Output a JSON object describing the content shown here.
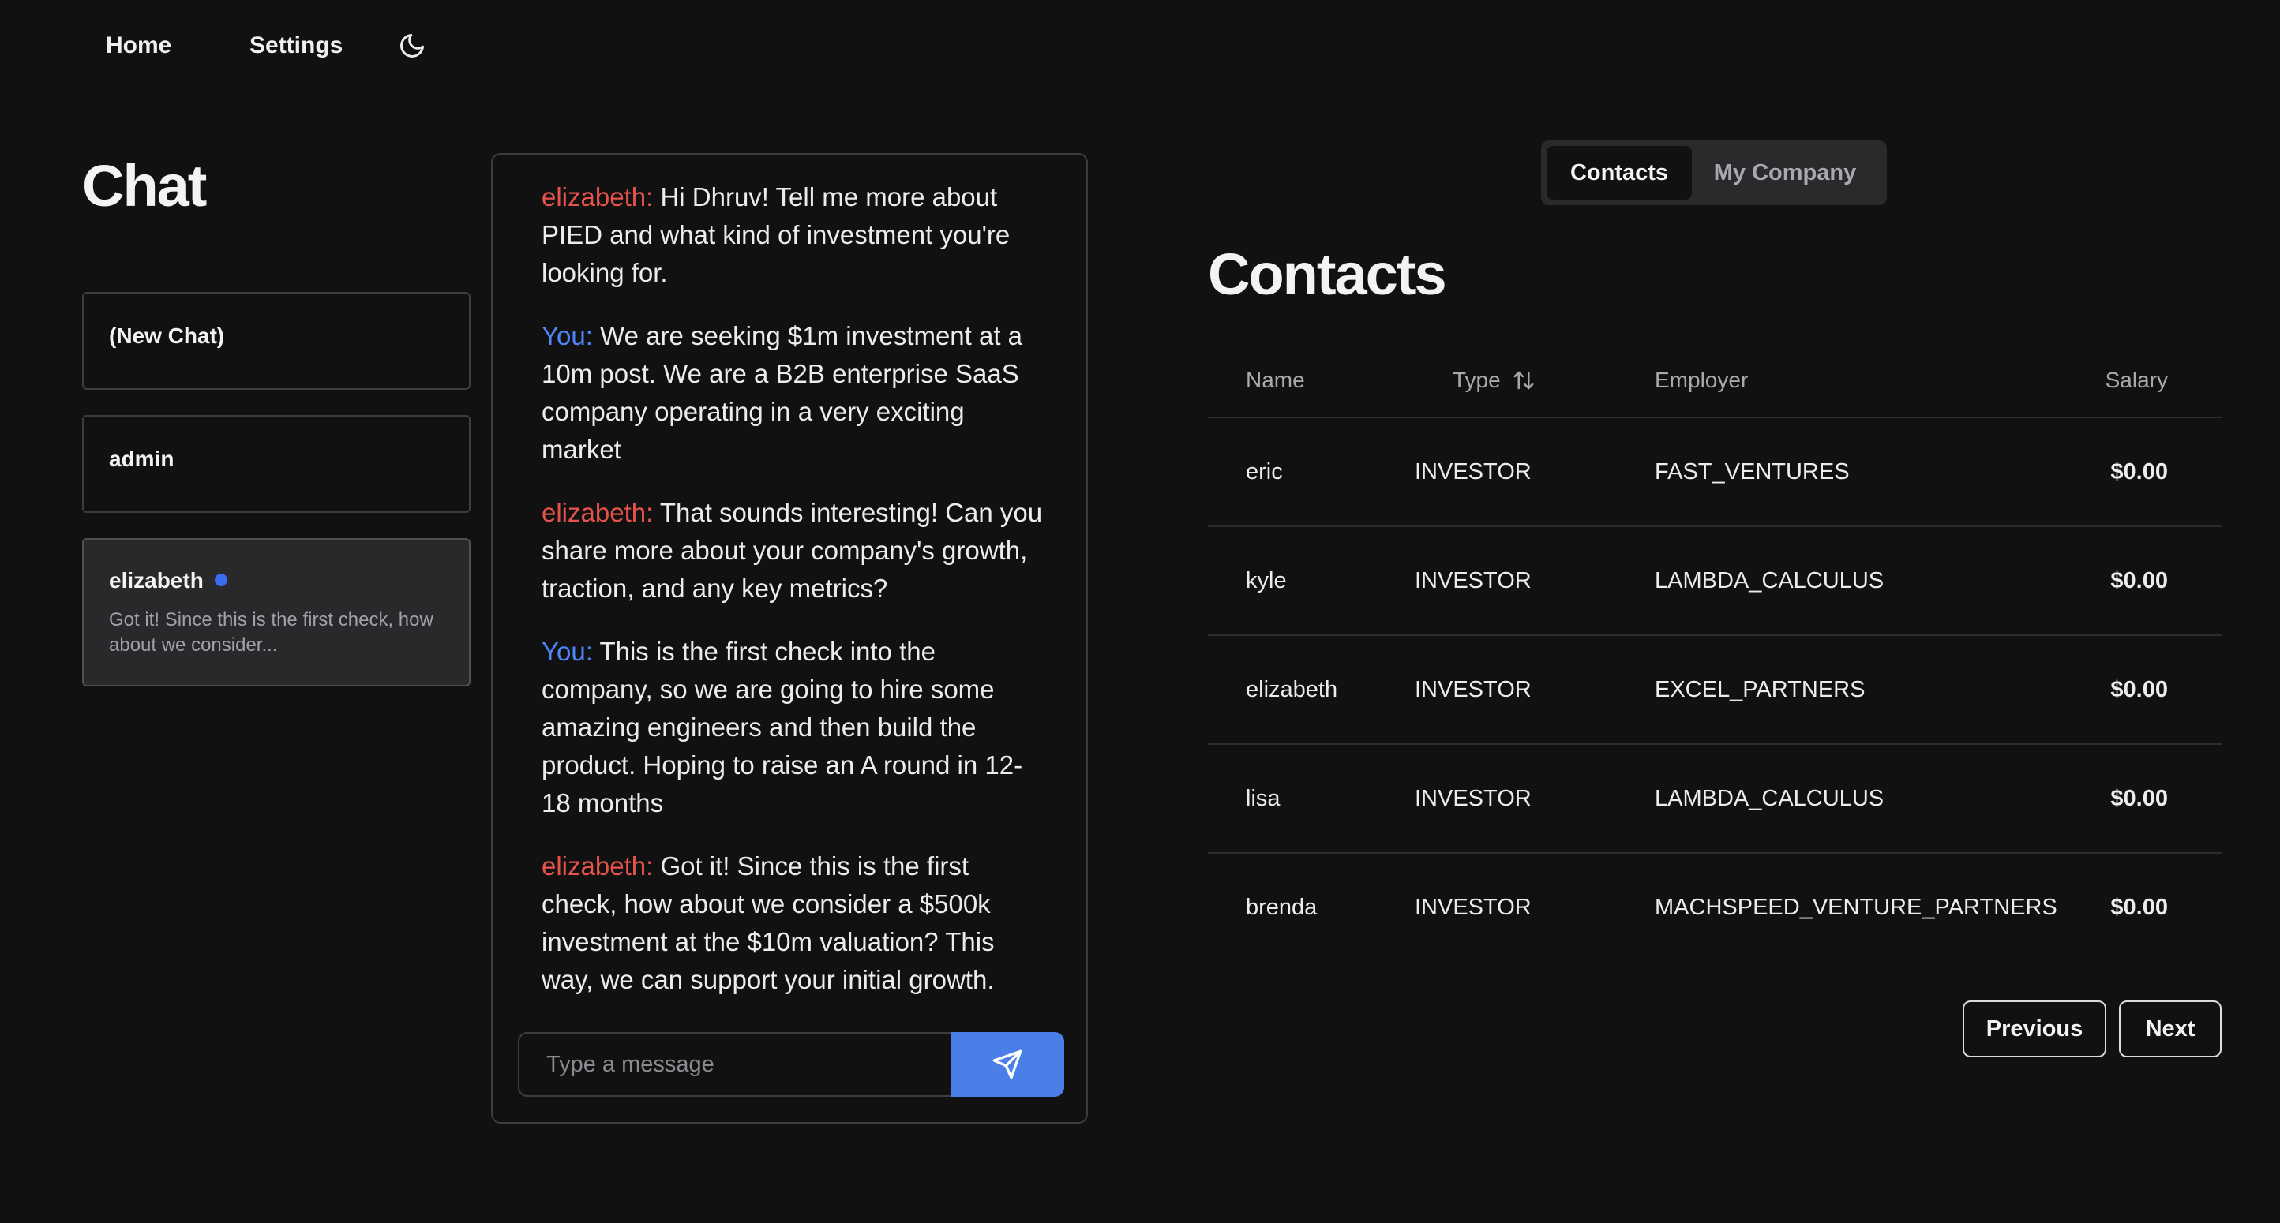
{
  "nav": {
    "home_label": "Home",
    "settings_label": "Settings",
    "theme_icon": "moon-icon"
  },
  "chat_panel": {
    "title": "Chat",
    "items": [
      {
        "name": "(New Chat)"
      },
      {
        "name": "admin"
      },
      {
        "name": "elizabeth",
        "unread": true,
        "preview": "Got it! Since this is the first check, how about we consider..."
      }
    ]
  },
  "conversation": {
    "messages": [
      {
        "sender": "elizabeth:",
        "text": "Hi Dhruv! Tell me more about PIED and what kind of investment you're looking for."
      },
      {
        "sender": "You:",
        "text": "We are seeking $1m investment at a 10m post. We are a B2B enterprise SaaS company operating in a very exciting market"
      },
      {
        "sender": "elizabeth:",
        "text": "That sounds interesting! Can you share more about your company's growth, traction, and any key metrics?"
      },
      {
        "sender": "You:",
        "text": "This is the first check into the company, so we are going to hire some amazing engineers and then build the product. Hoping to raise an A round in 12-18 months"
      },
      {
        "sender": "elizabeth:",
        "text": "Got it! Since this is the first check, how about we consider a $500k investment at the $10m valuation? This way, we can support your initial growth."
      }
    ],
    "input_placeholder": "Type a message",
    "input_value": "",
    "send_icon": "send-icon"
  },
  "tabs": [
    {
      "label": "Contacts",
      "active": true
    },
    {
      "label": "My Company",
      "active": false
    }
  ],
  "contacts": {
    "title": "Contacts",
    "columns": {
      "name": "Name",
      "type": "Type",
      "employer": "Employer",
      "salary": "Salary"
    },
    "rows": [
      {
        "name": "eric",
        "type": "INVESTOR",
        "employer": "FAST_VENTURES",
        "salary": "$0.00"
      },
      {
        "name": "kyle",
        "type": "INVESTOR",
        "employer": "LAMBDA_CALCULUS",
        "salary": "$0.00"
      },
      {
        "name": "elizabeth",
        "type": "INVESTOR",
        "employer": "EXCEL_PARTNERS",
        "salary": "$0.00"
      },
      {
        "name": "lisa",
        "type": "INVESTOR",
        "employer": "LAMBDA_CALCULUS",
        "salary": "$0.00"
      },
      {
        "name": "brenda",
        "type": "INVESTOR",
        "employer": "MACHSPEED_VENTURE_PARTNERS",
        "salary": "$0.00"
      }
    ]
  },
  "pagination": {
    "previous_label": "Previous",
    "next_label": "Next"
  },
  "colors": {
    "background": "#111112",
    "ai_sender": "#e5534b",
    "user_sender": "#4f86f7",
    "send_button": "#4a7fe8",
    "unread_dot": "#3b6cf0"
  }
}
